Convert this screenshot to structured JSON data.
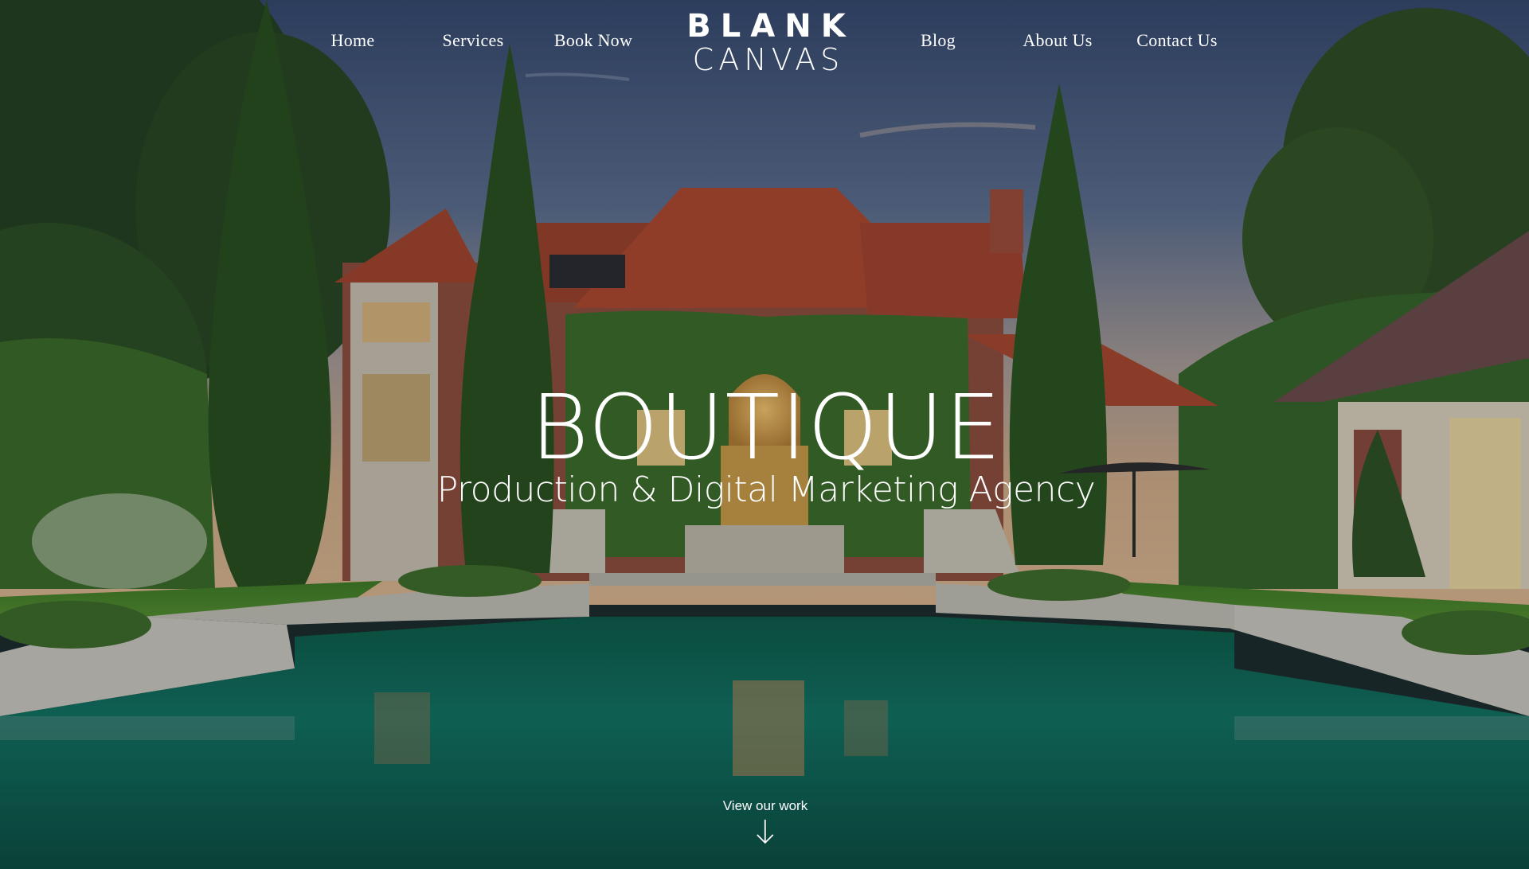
{
  "brand": {
    "line1": "BLANK",
    "line2": "CANVAS"
  },
  "nav": {
    "home": "Home",
    "services": "Services",
    "book": "Book Now",
    "blog": "Blog",
    "about": "About Us",
    "contact": "Contact Us"
  },
  "hero": {
    "headline": "BOUTIQUE",
    "subheadline": "Production & Digital Marketing Agency",
    "cta": "View our work",
    "cta_icon": "arrow-down-icon"
  },
  "colors": {
    "sky_top": "#3a4e72",
    "sky_bottom": "#c9a685",
    "roof": "#a8442c",
    "brick": "#8a4a3a",
    "foliage": "#2f5a22",
    "cypress": "#264d1c",
    "lawn": "#4d8a2c",
    "pool": "#0f6e58",
    "text": "#ffffff"
  }
}
